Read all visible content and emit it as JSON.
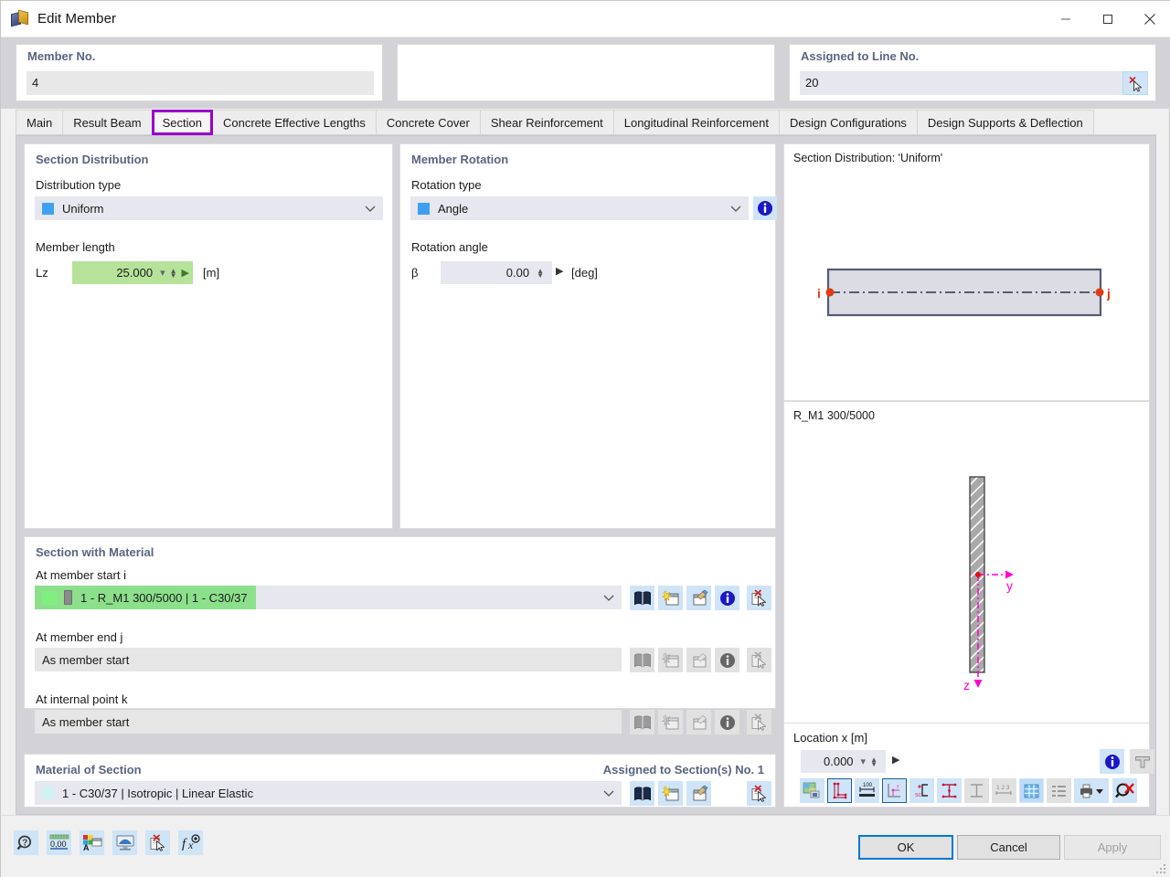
{
  "window": {
    "title": "Edit Member",
    "icon": "member-cube-icon",
    "minimize_label": "–",
    "maximize_label": "□",
    "close_label": "✕"
  },
  "header": {
    "member_no": {
      "label": "Member No.",
      "value": "4"
    },
    "assigned_line": {
      "label": "Assigned to Line No.",
      "value": "20",
      "pick_icon": "select-deselect-cursor-icon"
    }
  },
  "tabs": [
    {
      "label": "Main",
      "active": false
    },
    {
      "label": "Result Beam",
      "active": false
    },
    {
      "label": "Section",
      "active": true
    },
    {
      "label": "Concrete Effective Lengths",
      "active": false
    },
    {
      "label": "Concrete Cover",
      "active": false
    },
    {
      "label": "Shear Reinforcement",
      "active": false
    },
    {
      "label": "Longitudinal Reinforcement",
      "active": false
    },
    {
      "label": "Design Configurations",
      "active": false
    },
    {
      "label": "Design Supports & Deflection",
      "active": false
    }
  ],
  "section_distribution": {
    "title": "Section Distribution",
    "distribution_type_label": "Distribution type",
    "distribution_type_value": "Uniform",
    "member_length_label": "Member length",
    "length_symbol": "Lz",
    "length_value": "25.000",
    "length_unit": "[m]"
  },
  "member_rotation": {
    "title": "Member Rotation",
    "rotation_type_label": "Rotation type",
    "rotation_type_value": "Angle",
    "rotation_angle_label": "Rotation angle",
    "angle_symbol": "β",
    "angle_value": "0.00",
    "angle_unit": "[deg]",
    "info_icon": "info-icon"
  },
  "section_with_material": {
    "title": "Section with Material",
    "rows": [
      {
        "label": "At member start i",
        "value": "1 - R_M1 300/5000 | 1 - C30/37",
        "highlighted": true,
        "has_dropdown": true,
        "buttons_enabled": true
      },
      {
        "label": "At member end j",
        "value": "As member start",
        "highlighted": false,
        "has_dropdown": false,
        "buttons_enabled": false
      },
      {
        "label": "At internal point k",
        "value": "As member start",
        "highlighted": false,
        "has_dropdown": false,
        "buttons_enabled": false
      }
    ],
    "row_buttons": [
      "library-icon",
      "new-section-icon",
      "edit-section-icon",
      "info-icon",
      "delete-pick-icon"
    ]
  },
  "material_of_section": {
    "title": "Material of Section",
    "assigned_note": "Assigned to Section(s) No. 1",
    "value": "1 - C30/37 | Isotropic | Linear Elastic",
    "buttons": [
      "library-icon",
      "new-material-icon",
      "edit-material-icon",
      "delete-pick-icon"
    ]
  },
  "preview_distribution": {
    "caption": "Section Distribution: 'Uniform'",
    "node_start": "i",
    "node_end": "j"
  },
  "preview_section": {
    "caption": "R_M1 300/5000",
    "axis_y": "y",
    "axis_z": "z"
  },
  "location_x": {
    "label": "Location x [m]",
    "value": "0.000",
    "info_icon": "info-icon",
    "table-icon": "tee-shape-icon"
  },
  "preview_toolbar": [
    {
      "name": "render-mode-icon",
      "state": "enabled"
    },
    {
      "name": "section-points-icon",
      "state": "active"
    },
    {
      "name": "dimensions-icon",
      "state": "enabled"
    },
    {
      "name": "axes-system-icon",
      "state": "active"
    },
    {
      "name": "shear-center-icon",
      "state": "enabled"
    },
    {
      "name": "stress-points-icon",
      "state": "enabled"
    },
    {
      "name": "parts-icon",
      "state": "disabled"
    },
    {
      "name": "numbering-icon",
      "state": "disabled"
    },
    {
      "name": "grid-icon",
      "state": "active"
    },
    {
      "name": "table-list-icon",
      "state": "disabled"
    },
    {
      "name": "print-dropdown-icon",
      "state": "enabled"
    },
    {
      "name": "zoom-reset-icon",
      "state": "enabled"
    }
  ],
  "footer_toolbar": [
    {
      "name": "help-icon"
    },
    {
      "name": "units-decimals-icon"
    },
    {
      "name": "display-properties-icon"
    },
    {
      "name": "view-mode-icon"
    },
    {
      "name": "delete-pick-icon"
    },
    {
      "name": "formula-icon"
    }
  ],
  "footer_buttons": {
    "ok": "OK",
    "cancel": "Cancel",
    "apply": "Apply"
  },
  "colors": {
    "accent_tab_highlight": "#9900cc",
    "field_blue": "#e7e7ef",
    "highlight_green": "#b6e29a",
    "selected_green": "#8ce08c",
    "window_chrome": "#d3d3d7",
    "node_marker_red": "#e03c10",
    "axis_magenta": "#ff00d0",
    "info_blue": "#1818c8"
  }
}
